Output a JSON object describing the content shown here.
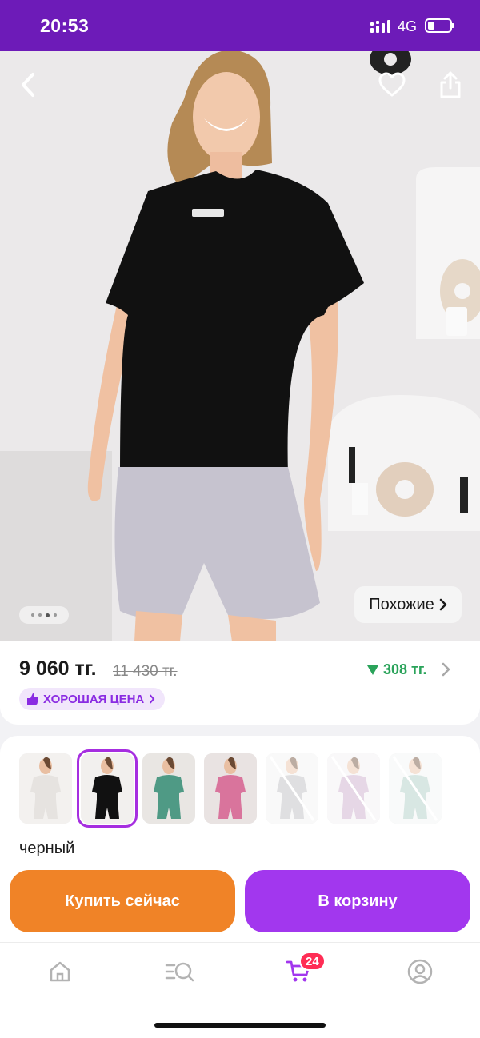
{
  "status_bar": {
    "time": "20:53",
    "network": "4G",
    "signal_icon": "signal-icon",
    "battery_icon": "battery-icon",
    "battery_level": 0.3
  },
  "hero": {
    "back_icon": "chevron-left-icon",
    "favorite_icon": "heart-icon",
    "share_icon": "share-icon",
    "image_count": 4,
    "active_image": 3,
    "similar_label": "Похожие"
  },
  "price": {
    "current": "9 060 тг.",
    "old": "11 430 тг.",
    "bonus": "308 тг.",
    "good_price_label": "ХОРОШАЯ ЦЕНА",
    "colors": {
      "accent": "#8a2be2",
      "bonus": "#2aa35a"
    }
  },
  "variants": {
    "items": [
      {
        "name": "white",
        "available": true,
        "selected": false
      },
      {
        "name": "black",
        "available": true,
        "selected": true
      },
      {
        "name": "green",
        "available": true,
        "selected": false
      },
      {
        "name": "pink",
        "available": true,
        "selected": false
      },
      {
        "name": "grey",
        "available": false,
        "selected": false
      },
      {
        "name": "lilac",
        "available": false,
        "selected": false
      },
      {
        "name": "mint",
        "available": false,
        "selected": false
      }
    ],
    "selected_color": "черный"
  },
  "actions": {
    "buy_now": "Купить сейчас",
    "add_to_cart": "В корзину",
    "colors": {
      "buy": "#f08327",
      "cart": "#a237ee"
    }
  },
  "bottom_nav": {
    "items": [
      {
        "name": "home",
        "icon": "home-icon"
      },
      {
        "name": "catalog",
        "icon": "catalog-search-icon"
      },
      {
        "name": "cart",
        "icon": "cart-icon",
        "active": true
      },
      {
        "name": "profile",
        "icon": "profile-icon"
      }
    ],
    "cart_count": "24"
  }
}
